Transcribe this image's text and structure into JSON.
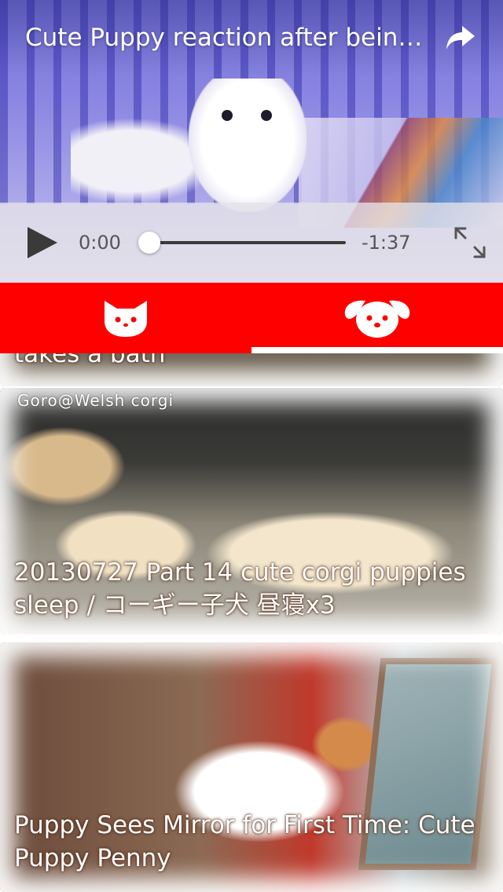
{
  "player": {
    "title": "Cute Puppy reaction after bein…",
    "current_time": "0:00",
    "remaining_time": "-1:37",
    "progress": 0
  },
  "tabs": [
    {
      "icon": "cat-face-icon",
      "active": false
    },
    {
      "icon": "dog-face-icon",
      "active": true
    }
  ],
  "videos": [
    {
      "title": "takes a bath",
      "watermark": ""
    },
    {
      "title": "20130727 Part 14 cute corgi puppies sleep / コーギー子犬 昼寝x3",
      "watermark": "Goro@Welsh corgi"
    },
    {
      "title": "Puppy Sees Mirror for First Time: Cute Puppy Penny",
      "watermark": ""
    }
  ],
  "colors": {
    "accent": "#ff0000",
    "tab_indicator": "#ffffff",
    "control_bar": "#e4e2e8"
  }
}
